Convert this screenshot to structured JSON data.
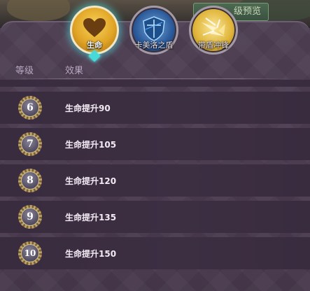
{
  "header": {
    "preview_button": "级预览"
  },
  "tabs": [
    {
      "label": "生命",
      "icon": "heart-icon",
      "active": true
    },
    {
      "label": "卡美洛之盾",
      "icon": "shield-icon",
      "active": false
    },
    {
      "label": "带盾冲锋",
      "icon": "shield-rush-icon",
      "active": false
    }
  ],
  "table": {
    "columns": [
      "等级",
      "效果"
    ],
    "rows": [
      {
        "level": "6",
        "effect_prefix": "生命提升",
        "effect_value": "90"
      },
      {
        "level": "7",
        "effect_prefix": "生命提升",
        "effect_value": "105"
      },
      {
        "level": "8",
        "effect_prefix": "生命提升",
        "effect_value": "120"
      },
      {
        "level": "9",
        "effect_prefix": "生命提升",
        "effect_value": "135"
      },
      {
        "level": "10",
        "effect_prefix": "生命提升",
        "effect_value": "150"
      }
    ]
  },
  "colors": {
    "panel": "#4a3b4f",
    "row": "#3d2f42",
    "active_glow": "#48d9d9",
    "header_text": "#b9a8c2"
  }
}
